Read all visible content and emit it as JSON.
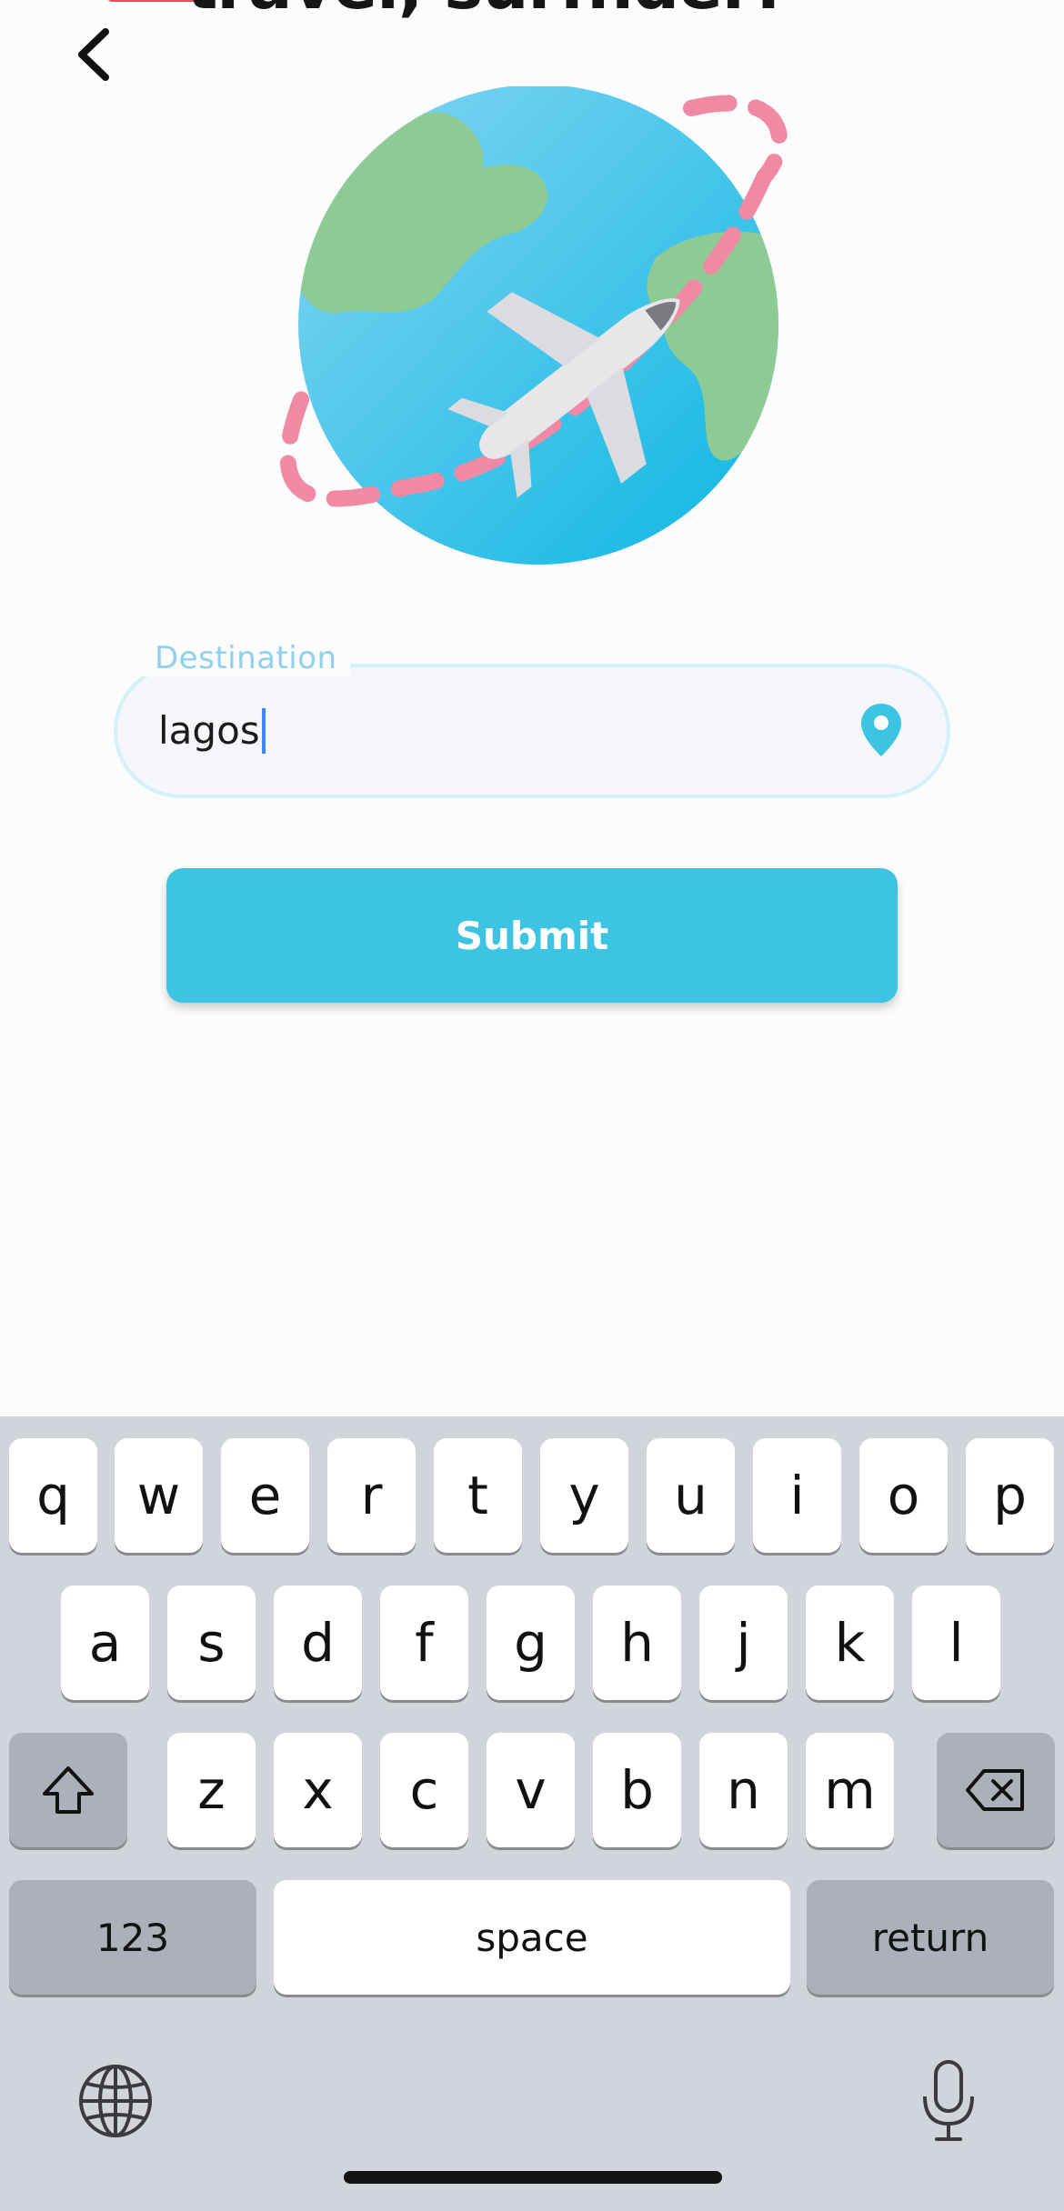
{
  "header": {
    "title": "travel, surfnder!",
    "accent_color": "#e8505b",
    "back_icon": "chevron-left-icon"
  },
  "illustration": {
    "name": "globe-with-airplane",
    "colors": {
      "ocean": "#4cc3ea",
      "land": "#8ecb94",
      "trail": "#f08aa4",
      "plane": "#e7e7ea"
    }
  },
  "form": {
    "destination_label": "Destination",
    "destination_value": "lagos",
    "destination_icon": "location-pin-icon",
    "submit_label": "Submit",
    "accent_color": "#3dc4e2"
  },
  "keyboard": {
    "row1": [
      "q",
      "w",
      "e",
      "r",
      "t",
      "y",
      "u",
      "i",
      "o",
      "p"
    ],
    "row2": [
      "a",
      "s",
      "d",
      "f",
      "g",
      "h",
      "j",
      "k",
      "l"
    ],
    "row3": [
      "z",
      "x",
      "c",
      "v",
      "b",
      "n",
      "m"
    ],
    "numbers_label": "123",
    "space_label": "space",
    "return_label": "return",
    "shift_icon": "shift-icon",
    "delete_icon": "backspace-icon",
    "globe_icon": "globe-icon",
    "mic_icon": "microphone-icon"
  }
}
